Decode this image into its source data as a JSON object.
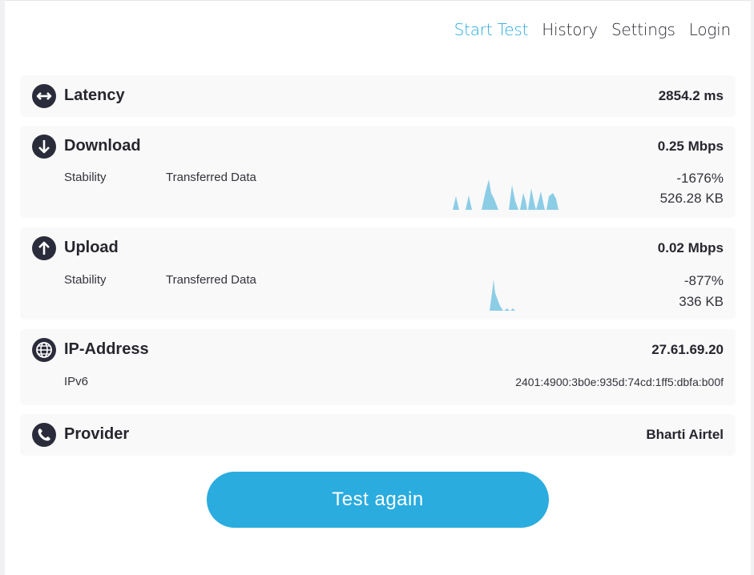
{
  "nav": {
    "items": [
      {
        "label": "Start Test",
        "active": true
      },
      {
        "label": "History",
        "active": false
      },
      {
        "label": "Settings",
        "active": false
      },
      {
        "label": "Login",
        "active": false
      }
    ]
  },
  "latency": {
    "title": "Latency",
    "value": "2854.2 ms",
    "icon": "arrows-left-right-icon"
  },
  "download": {
    "title": "Download",
    "value": "0.25 Mbps",
    "stability_label": "Stability",
    "transferred_label": "Transferred Data",
    "stability_value": "-1676%",
    "transferred_value": "526.28 KB",
    "icon": "arrow-down-icon"
  },
  "upload": {
    "title": "Upload",
    "value": "0.02 Mbps",
    "stability_label": "Stability",
    "transferred_label": "Transferred Data",
    "stability_value": "-877%",
    "transferred_value": "336 KB",
    "icon": "arrow-up-icon"
  },
  "ip": {
    "title": "IP-Address",
    "value": "27.61.69.20",
    "ipv6_label": "IPv6",
    "ipv6_value": "2401:4900:3b0e:935d:74cd:1ff5:dbfa:b00f",
    "icon": "globe-icon"
  },
  "provider": {
    "title": "Provider",
    "value": "Bharti Airtel",
    "icon": "phone-icon"
  },
  "action": {
    "label": "Test again"
  },
  "colors": {
    "accent": "#2aacdf",
    "sparkline": "#8ccde6",
    "icon_bg": "#2b2c3b"
  }
}
